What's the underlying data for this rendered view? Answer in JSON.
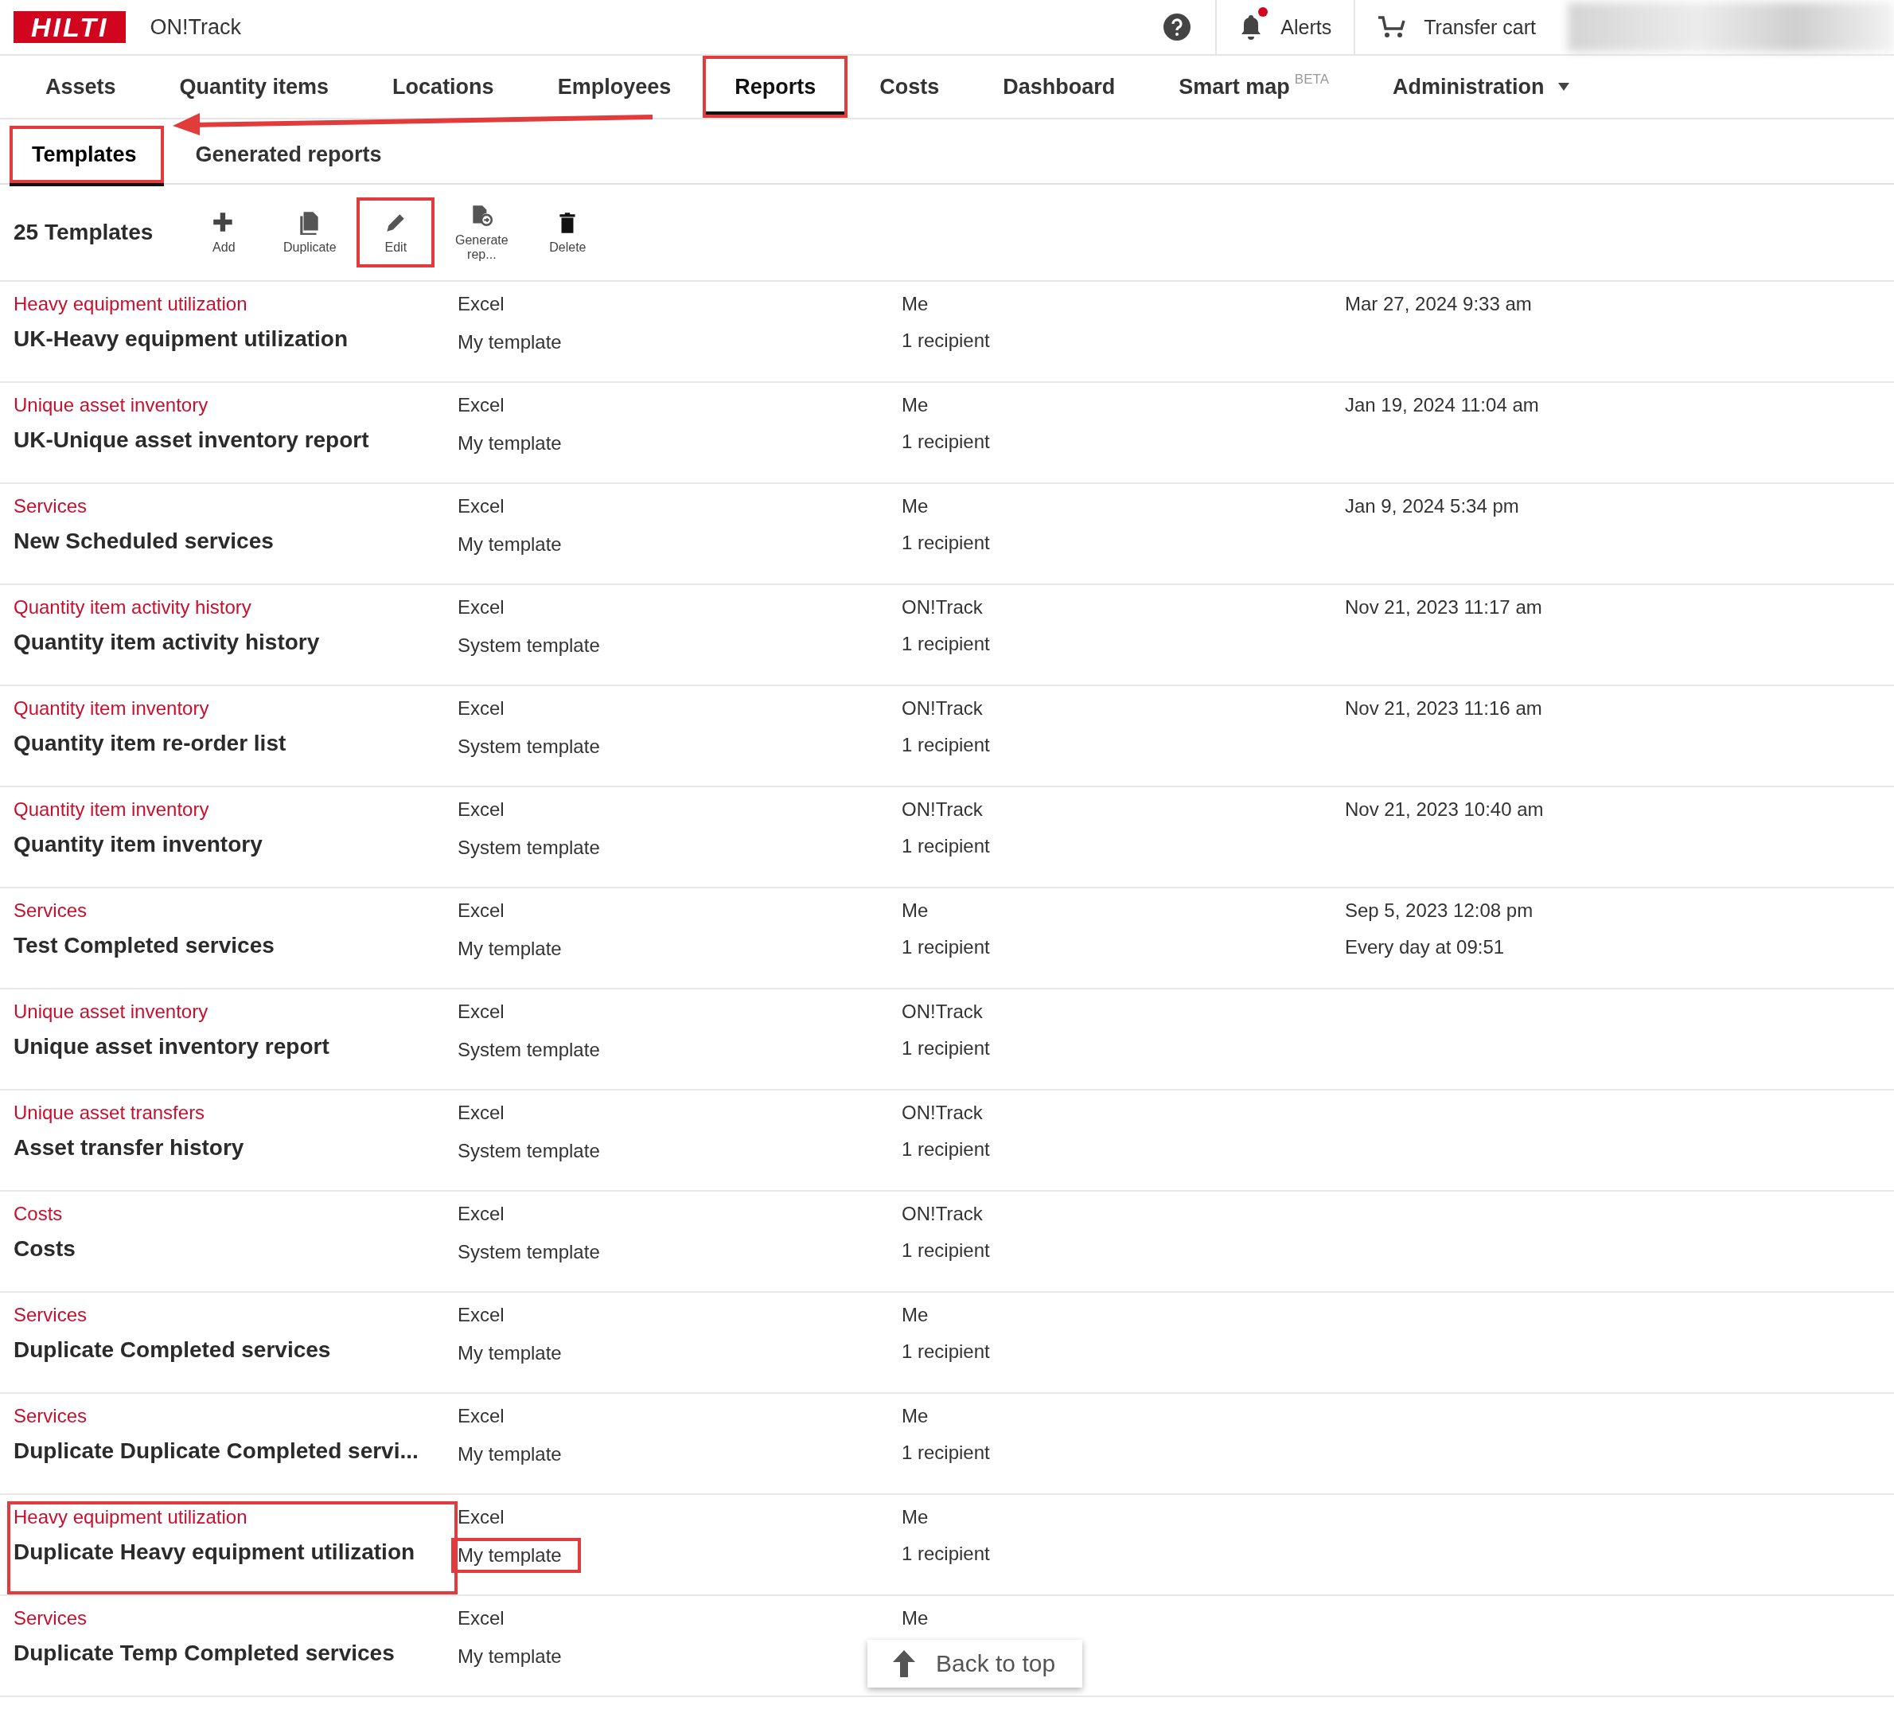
{
  "header": {
    "logo": "HILTI",
    "app_name": "ON!Track",
    "alerts": {
      "label": "Alerts",
      "unread": true
    },
    "cart": {
      "label": "Transfer cart"
    }
  },
  "nav": [
    {
      "label": "Assets",
      "selected": false,
      "highlighted": false
    },
    {
      "label": "Quantity items",
      "selected": false,
      "highlighted": false
    },
    {
      "label": "Locations",
      "selected": false,
      "highlighted": false
    },
    {
      "label": "Employees",
      "selected": false,
      "highlighted": false
    },
    {
      "label": "Reports",
      "selected": true,
      "highlighted": true
    },
    {
      "label": "Costs",
      "selected": false,
      "highlighted": false
    },
    {
      "label": "Dashboard",
      "selected": false,
      "highlighted": false
    },
    {
      "label": "Smart map",
      "badge": "BETA",
      "selected": false,
      "highlighted": false
    },
    {
      "label": "Administration",
      "dropdown": true,
      "selected": false,
      "highlighted": false
    }
  ],
  "subtabs": [
    {
      "label": "Templates",
      "selected": true,
      "highlighted": true
    },
    {
      "label": "Generated reports",
      "selected": false,
      "highlighted": false
    }
  ],
  "toolbar": {
    "count": "25 Templates",
    "actions": [
      {
        "kind": "add",
        "label": "Add",
        "highlighted": false
      },
      {
        "kind": "duplicate",
        "label": "Duplicate",
        "highlighted": false
      },
      {
        "kind": "edit",
        "label": "Edit",
        "highlighted": true
      },
      {
        "kind": "generate",
        "label": "Generate rep...",
        "highlighted": false
      },
      {
        "kind": "delete",
        "label": "Delete",
        "highlighted": false
      }
    ]
  },
  "rows": [
    {
      "category": "Heavy equipment utilization",
      "name": "UK-Heavy equipment utilization",
      "format": "Excel",
      "type": "My template",
      "owner": "Me",
      "recipients": "1 recipient",
      "date": "Mar 27, 2024 9:33 am",
      "highlight_name": false,
      "highlight_type": false
    },
    {
      "category": "Unique asset inventory",
      "name": "UK-Unique asset inventory report",
      "format": "Excel",
      "type": "My template",
      "owner": "Me",
      "recipients": "1 recipient",
      "date": "Jan 19, 2024 11:04 am",
      "highlight_name": false,
      "highlight_type": false
    },
    {
      "category": "Services",
      "name": "New Scheduled services",
      "format": "Excel",
      "type": "My template",
      "owner": "Me",
      "recipients": "1 recipient",
      "date": "Jan 9, 2024 5:34 pm",
      "highlight_name": false,
      "highlight_type": false
    },
    {
      "category": "Quantity item activity history",
      "name": "Quantity item activity history",
      "format": "Excel",
      "type": "System template",
      "owner": "ON!Track",
      "recipients": "1 recipient",
      "date": "Nov 21, 2023 11:17 am",
      "highlight_name": false,
      "highlight_type": false
    },
    {
      "category": "Quantity item inventory",
      "name": "Quantity item re-order list",
      "format": "Excel",
      "type": "System template",
      "owner": "ON!Track",
      "recipients": "1 recipient",
      "date": "Nov 21, 2023 11:16 am",
      "highlight_name": false,
      "highlight_type": false
    },
    {
      "category": "Quantity item inventory",
      "name": "Quantity item inventory",
      "format": "Excel",
      "type": "System template",
      "owner": "ON!Track",
      "recipients": "1 recipient",
      "date": "Nov 21, 2023 10:40 am",
      "highlight_name": false,
      "highlight_type": false
    },
    {
      "category": "Services",
      "name": "Test Completed services",
      "format": "Excel",
      "type": "My template",
      "owner": "Me",
      "recipients": "1 recipient",
      "date": "Sep 5, 2023 12:08 pm",
      "schedule": "Every day at 09:51",
      "highlight_name": false,
      "highlight_type": false
    },
    {
      "category": "Unique asset inventory",
      "name": "Unique asset inventory report",
      "format": "Excel",
      "type": "System template",
      "owner": "ON!Track",
      "recipients": "1 recipient",
      "highlight_name": false,
      "highlight_type": false
    },
    {
      "category": "Unique asset transfers",
      "name": "Asset transfer history",
      "format": "Excel",
      "type": "System template",
      "owner": "ON!Track",
      "recipients": "1 recipient",
      "highlight_name": false,
      "highlight_type": false
    },
    {
      "category": "Costs",
      "name": "Costs",
      "format": "Excel",
      "type": "System template",
      "owner": "ON!Track",
      "recipients": "1 recipient",
      "highlight_name": false,
      "highlight_type": false
    },
    {
      "category": "Services",
      "name": "Duplicate Completed services",
      "format": "Excel",
      "type": "My template",
      "owner": "Me",
      "recipients": "1 recipient",
      "highlight_name": false,
      "highlight_type": false
    },
    {
      "category": "Services",
      "name": "Duplicate Duplicate Completed servi...",
      "format": "Excel",
      "type": "My template",
      "owner": "Me",
      "recipients": "1 recipient",
      "highlight_name": false,
      "highlight_type": false
    },
    {
      "category": "Heavy equipment utilization",
      "name": "Duplicate Heavy equipment utilization",
      "format": "Excel",
      "type": "My template",
      "owner": "Me",
      "recipients": "1 recipient",
      "highlight_name": true,
      "highlight_type": true
    },
    {
      "category": "Services",
      "name": "Duplicate Temp Completed services",
      "format": "Excel",
      "type": "My template",
      "owner": "Me",
      "highlight_name": false,
      "highlight_type": false
    }
  ],
  "back_to_top": "Back to top"
}
